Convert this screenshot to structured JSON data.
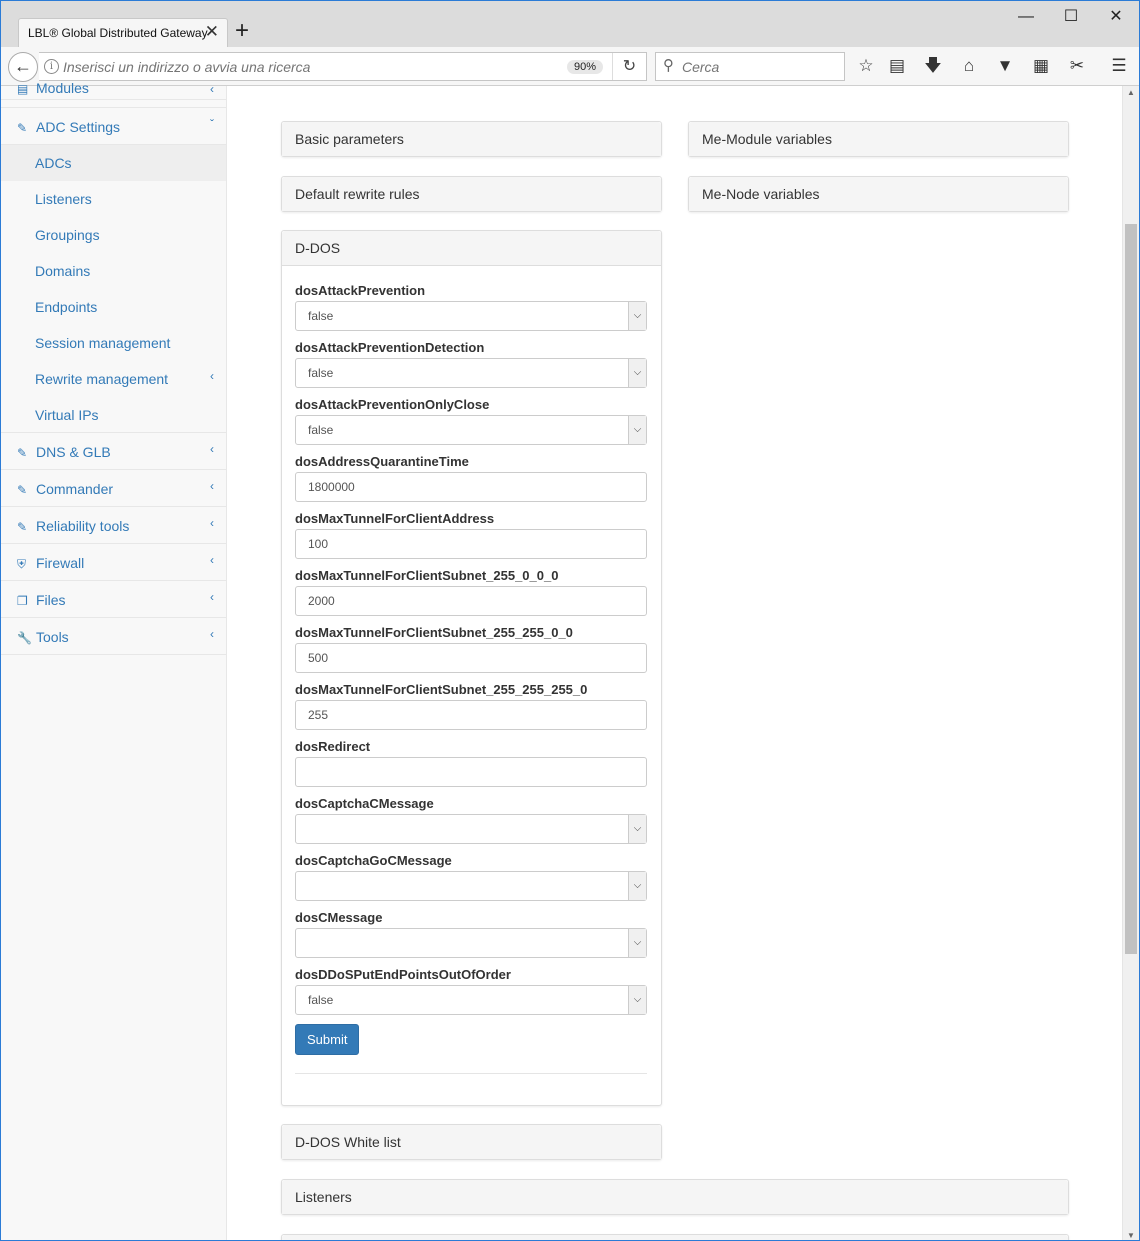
{
  "browser": {
    "tab_title": "LBL® Global Distributed Gateway",
    "tab_close": "✕",
    "new_tab": "+",
    "url_placeholder": "Inserisci un indirizzo o avvia una ricerca",
    "zoom": "90%",
    "search_placeholder": "Cerca",
    "accent_color": "#2b7bd6"
  },
  "sidebar": {
    "items": [
      {
        "label": "Modules",
        "icon": "list-icon"
      },
      {
        "label": "ADC Settings",
        "icon": "edit-icon"
      },
      {
        "label": "DNS & GLB",
        "icon": "edit-icon"
      },
      {
        "label": "Commander",
        "icon": "edit-icon"
      },
      {
        "label": "Reliability tools",
        "icon": "edit-icon"
      },
      {
        "label": "Firewall",
        "icon": "shield-icon"
      },
      {
        "label": "Files",
        "icon": "files-icon"
      },
      {
        "label": "Tools",
        "icon": "wrench-icon"
      }
    ],
    "adc_sub": [
      "ADCs",
      "Listeners",
      "Groupings",
      "Domains",
      "Endpoints",
      "Session management",
      "Rewrite management",
      "Virtual IPs"
    ],
    "link_color": "#337ab7"
  },
  "panels": {
    "basic": "Basic parameters",
    "me_module": "Me-Module variables",
    "default_rewrite": "Default rewrite rules",
    "me_node": "Me-Node variables",
    "ddos": "D-DOS",
    "ddos_white": "D-DOS White list",
    "listeners": "Listeners"
  },
  "form": {
    "fields": [
      {
        "label": "dosAttackPrevention",
        "value": "false"
      },
      {
        "label": "dosAttackPreventionDetection",
        "value": "false"
      },
      {
        "label": "dosAttackPreventionOnlyClose",
        "value": "false"
      },
      {
        "label": "dosAddressQuarantineTime",
        "value": "1800000"
      },
      {
        "label": "dosMaxTunnelForClientAddress",
        "value": "100"
      },
      {
        "label": "dosMaxTunnelForClientSubnet_255_0_0_0",
        "value": "2000"
      },
      {
        "label": "dosMaxTunnelForClientSubnet_255_255_0_0",
        "value": "500"
      },
      {
        "label": "dosMaxTunnelForClientSubnet_255_255_255_0",
        "value": "255"
      },
      {
        "label": "dosRedirect",
        "value": ""
      },
      {
        "label": "dosCaptchaCMessage",
        "value": ""
      },
      {
        "label": "dosCaptchaGoCMessage",
        "value": ""
      },
      {
        "label": "dosCMessage",
        "value": ""
      },
      {
        "label": "dosDDoSPutEndPointsOutOfOrder",
        "value": "false"
      }
    ],
    "submit": "Submit",
    "button_color": "#337ab7"
  }
}
